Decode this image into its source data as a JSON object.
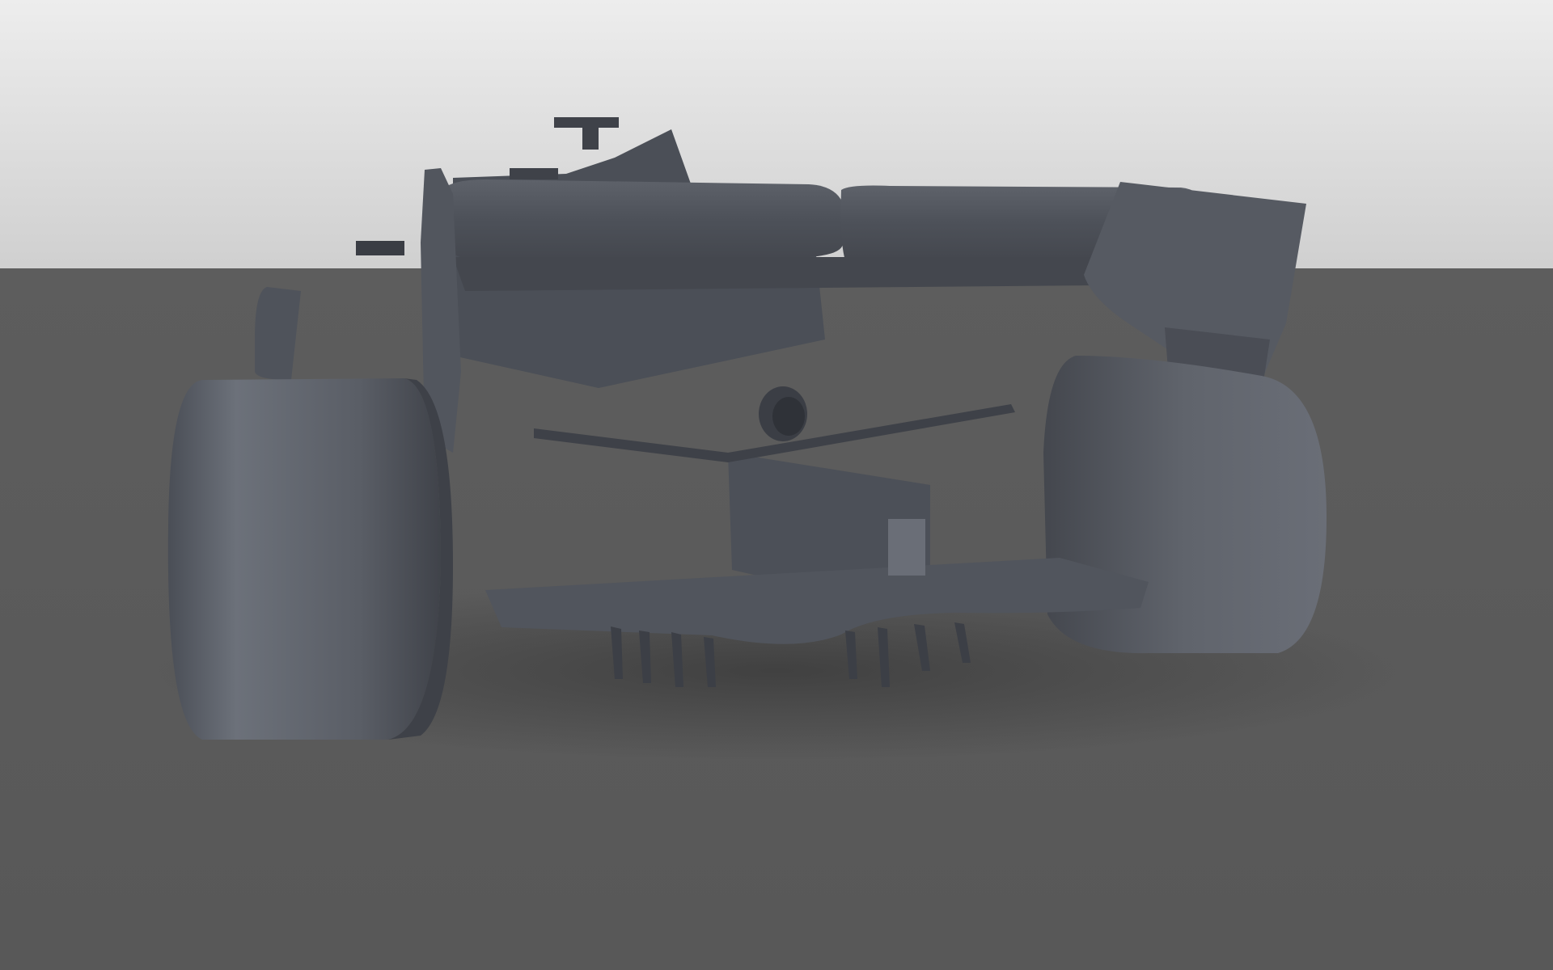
{
  "scene": {
    "subject": "f1-car-rear-clay-render",
    "colors": {
      "backdrop_top": "#ececec",
      "backdrop_bottom": "#cfcfcf",
      "floor": "#5b5b5b",
      "car_body": "#50545c",
      "car_dark": "#3a3d44",
      "car_light": "#6c7079",
      "tyre": "#5e626a",
      "tyre_highlight": "#7b8089"
    }
  }
}
